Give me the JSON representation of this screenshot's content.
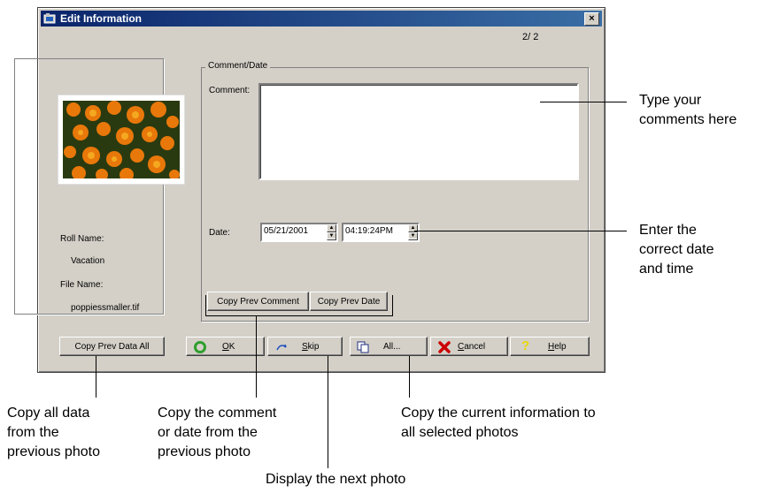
{
  "window": {
    "title": "Edit Information",
    "close_glyph": "×",
    "counter": "2/ 2"
  },
  "left_panel": {
    "photo_icon": "photo-thumbnail-poppies",
    "roll_name_label": "Roll Name:",
    "roll_name_value": "Vacation",
    "file_name_label": "File Name:",
    "file_name_value": "poppiessmaller.tif"
  },
  "comment_date_group": {
    "label": "Comment/Date",
    "comment_label": "Comment:",
    "comment_value": "",
    "date_label": "Date:",
    "date_value": "05/21/2001",
    "time_value": "04:19:24PM",
    "copy_prev_comment": "Copy Prev Comment",
    "copy_prev_date": "Copy Prev Date"
  },
  "buttons": {
    "copy_prev_data_all": "Copy Prev Data All",
    "ok_key": "O",
    "ok_rest": "K",
    "skip_key": "S",
    "skip_rest": "kip",
    "all": "All...",
    "cancel_key": "C",
    "cancel_rest": "ancel",
    "help_key": "H",
    "help_rest": "elp"
  },
  "callouts": {
    "comments_1": "Type your",
    "comments_2": "comments here",
    "date_1": "Enter the",
    "date_2": "correct date",
    "date_3": "and time",
    "copy_all_1": "Copy all data",
    "copy_all_2": "from the",
    "copy_all_3": "previous photo",
    "copy_comment_1": "Copy the comment",
    "copy_comment_2": "or date from the",
    "copy_comment_3": "previous photo",
    "copy_current_1": "Copy the current information to",
    "copy_current_2": "all selected photos",
    "next_photo": "Display the next photo"
  },
  "colors": {
    "titlebar": "#0a246a",
    "dialog_face": "#d4d0c8",
    "ok_icon": "#2e9e2e",
    "cancel_icon": "#cc0000",
    "help_icon": "#e8d800",
    "skip_icon": "#2050c0"
  }
}
